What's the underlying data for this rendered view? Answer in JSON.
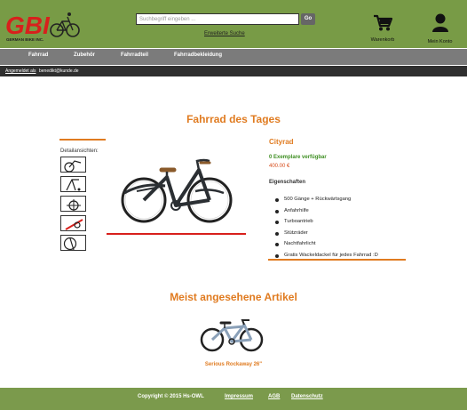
{
  "header": {
    "logo_text": "GBI",
    "logo_tagline": "GERMAN BIKE INC.",
    "search_placeholder": "Suchbegriff eingeben ...",
    "go_label": "Go",
    "advanced_search": "Erweiterte Suche",
    "cart_label": "Warenkorb",
    "account_label": "Mein Konto"
  },
  "nav": [
    "Fahrrad",
    "Zubehör",
    "Fahrradteil",
    "Fahrradbekleidung"
  ],
  "status": {
    "logged_in_as": "Angemeldet als",
    "email": "benedikt@kunde.de"
  },
  "daily": {
    "heading": "Fahrrad des Tages",
    "thumbs_label": "Detailansichten:",
    "product_name": "Cityrad",
    "stock": "0 Exemplare verfügbar",
    "price": "400.00 €",
    "properties_label": "Eigenschaften",
    "features": [
      "500 Gänge + Rückwärtsgang",
      "Anfahrhilfe",
      "Turboantrieb",
      "Stützräder",
      "Nachtfahrlicht",
      "Gratis Wackeldackel für jedes Fahrrad :D"
    ]
  },
  "most_viewed": {
    "heading": "Meist angesehene Artikel",
    "item_name": "Serious Rockaway 26\""
  },
  "footer": {
    "copyright": "Copyright © 2015 Hs-OWL",
    "links": [
      "Impressum",
      "AGB",
      "Datenschutz"
    ]
  },
  "colors": {
    "brand_green": "#789b46",
    "nav_gray": "#7b7b7b",
    "accent_orange": "#e07b20",
    "logo_red": "#d8201c"
  }
}
